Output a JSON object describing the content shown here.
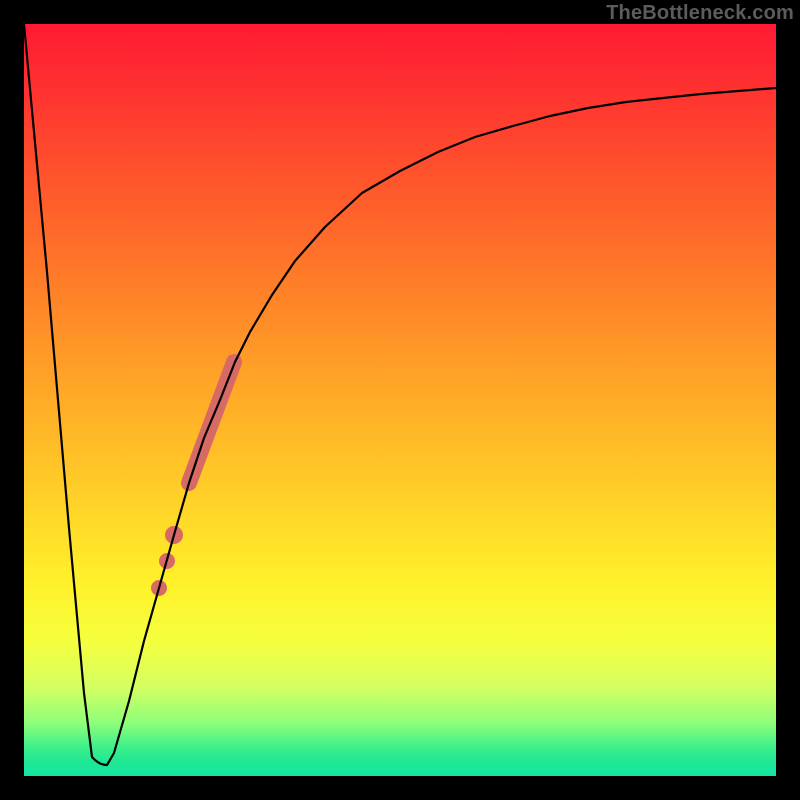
{
  "attribution": "TheBottleneck.com",
  "colors": {
    "frame": "#000000",
    "curve": "#000000",
    "highlight": "#d86a65",
    "gradient_top": "#ff1a33",
    "gradient_bottom": "#14e6a0"
  },
  "chart_data": {
    "type": "line",
    "title": "",
    "xlabel": "",
    "ylabel": "",
    "xlim": [
      0,
      100
    ],
    "ylim": [
      0,
      100
    ],
    "x": [
      0,
      3,
      6,
      8,
      9,
      10,
      11,
      12,
      14,
      16,
      18,
      20,
      22,
      24,
      26,
      28,
      30,
      33,
      36,
      40,
      45,
      50,
      55,
      60,
      65,
      70,
      75,
      80,
      85,
      90,
      95,
      100
    ],
    "values": [
      100,
      67,
      33,
      11,
      2.5,
      1.5,
      1.5,
      3,
      10,
      18,
      25,
      32,
      39,
      45,
      50,
      55,
      59,
      64,
      68.5,
      73,
      77.5,
      80.5,
      83,
      85,
      86.5,
      87.8,
      88.8,
      89.6,
      90.2,
      90.7,
      91.1,
      91.5
    ],
    "series": [
      {
        "name": "bottleneck-curve",
        "x": [
          0,
          3,
          6,
          8,
          9,
          10,
          11,
          12,
          14,
          16,
          18,
          20,
          22,
          24,
          26,
          28,
          30,
          33,
          36,
          40,
          45,
          50,
          55,
          60,
          65,
          70,
          75,
          80,
          85,
          90,
          95,
          100
        ],
        "values": [
          100,
          67,
          33,
          11,
          2.5,
          1.5,
          1.5,
          3,
          10,
          18,
          25,
          32,
          39,
          45,
          50,
          55,
          59,
          64,
          68.5,
          73,
          77.5,
          80.5,
          83,
          85,
          86.5,
          87.8,
          88.8,
          89.6,
          90.2,
          90.7,
          91.1,
          91.5
        ]
      }
    ],
    "annotations": {
      "highlight_segment": {
        "x_start": 22,
        "x_end": 28,
        "note": "thick salmon band on rising limb"
      },
      "highlight_points_x": [
        20,
        19,
        18
      ]
    }
  }
}
